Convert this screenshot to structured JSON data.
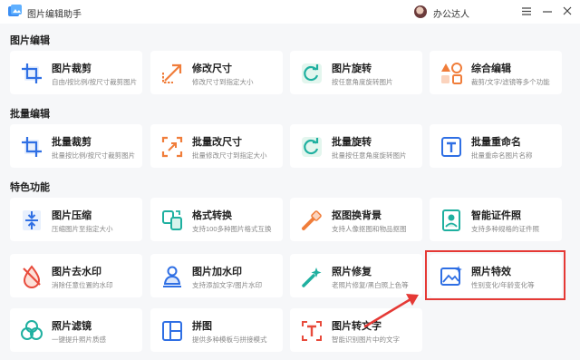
{
  "app": {
    "title": "图片编辑助手"
  },
  "user": {
    "name": "办公达人"
  },
  "sections": {
    "s1": {
      "title": "图片编辑"
    },
    "s2": {
      "title": "批量编辑"
    },
    "s3": {
      "title": "特色功能"
    }
  },
  "cards": {
    "crop": {
      "title": "图片裁剪",
      "desc": "自由/按比例/按尺寸裁剪图片"
    },
    "resize": {
      "title": "修改尺寸",
      "desc": "修改尺寸到指定大小"
    },
    "rotate": {
      "title": "图片旋转",
      "desc": "按任意角度旋转图片"
    },
    "edit": {
      "title": "综合编辑",
      "desc": "裁剪/文字/滤镜等多个功能"
    },
    "batch_crop": {
      "title": "批量裁剪",
      "desc": "批量按比例/按尺寸裁剪图片"
    },
    "batch_resize": {
      "title": "批量改尺寸",
      "desc": "批量修改尺寸到指定大小"
    },
    "batch_rotate": {
      "title": "批量旋转",
      "desc": "批量按任意角度旋转图片"
    },
    "batch_rename": {
      "title": "批量重命名",
      "desc": "批量重命名图片名称"
    },
    "compress": {
      "title": "图片压缩",
      "desc": "压缩图片至指定大小"
    },
    "convert": {
      "title": "格式转换",
      "desc": "支持100多种图片格式互换"
    },
    "cutout": {
      "title": "抠图换背景",
      "desc": "支持人像抠图和物品抠图"
    },
    "idphoto": {
      "title": "智能证件照",
      "desc": "支持多种规格的证件照"
    },
    "dewatermark": {
      "title": "图片去水印",
      "desc": "消除任意位置的水印"
    },
    "watermark": {
      "title": "图片加水印",
      "desc": "支持添加文字/图片水印"
    },
    "repair": {
      "title": "照片修复",
      "desc": "老照片修复/黑白照上色等"
    },
    "effects": {
      "title": "照片特效",
      "desc": "性别变化/年龄变化等"
    },
    "filter": {
      "title": "照片滤镜",
      "desc": "一键提升照片质感"
    },
    "collage": {
      "title": "拼图",
      "desc": "提供多种模板与拼接模式"
    },
    "ocr": {
      "title": "图片转文字",
      "desc": "智能识别图片中的文字"
    }
  },
  "colors": {
    "accent_blue": "#2f6fe4",
    "accent_cyan": "#1fb0c8",
    "accent_orange": "#f07d3a",
    "accent_red": "#e84b3c",
    "highlight": "#e53935"
  }
}
